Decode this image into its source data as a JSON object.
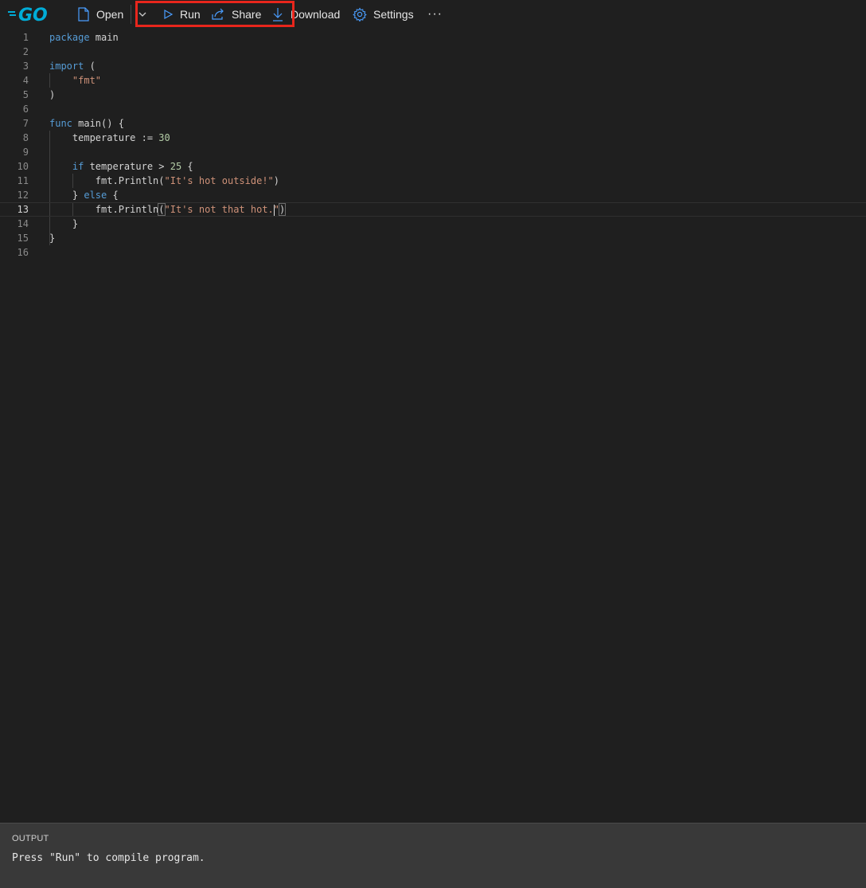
{
  "toolbar": {
    "logo_text": "GO",
    "open_label": "Open",
    "run_label": "Run",
    "share_label": "Share",
    "download_label": "Download",
    "settings_label": "Settings",
    "more_label": "···"
  },
  "editor": {
    "active_line": 13,
    "lines": [
      {
        "n": "1",
        "text": "package main"
      },
      {
        "n": "2",
        "text": ""
      },
      {
        "n": "3",
        "text": "import ("
      },
      {
        "n": "4",
        "text": "    \"fmt\""
      },
      {
        "n": "5",
        "text": ")"
      },
      {
        "n": "6",
        "text": ""
      },
      {
        "n": "7",
        "text": "func main() {"
      },
      {
        "n": "8",
        "text": "    temperature := 30"
      },
      {
        "n": "9",
        "text": ""
      },
      {
        "n": "10",
        "text": "    if temperature > 25 {"
      },
      {
        "n": "11",
        "text": "        fmt.Println(\"It's hot outside!\")"
      },
      {
        "n": "12",
        "text": "    } else {"
      },
      {
        "n": "13",
        "text": "        fmt.Println(\"It's not that hot.\")"
      },
      {
        "n": "14",
        "text": "    }"
      },
      {
        "n": "15",
        "text": "}"
      },
      {
        "n": "16",
        "text": ""
      }
    ]
  },
  "output": {
    "title": "OUTPUT",
    "text": "Press \"Run\" to compile program."
  },
  "colors": {
    "background": "#1f1f1f",
    "keyword": "#569cd6",
    "string": "#ce9178",
    "number": "#b5cea8",
    "highlight_box": "#e8261c",
    "go_brand": "#00acd7"
  }
}
